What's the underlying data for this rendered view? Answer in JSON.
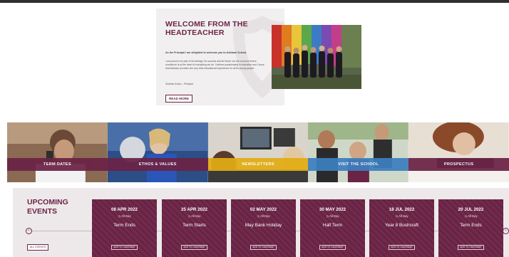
{
  "welcome": {
    "title": "WELCOME FROM THE HEADTEACHER",
    "intro": "As the Principal I am delighted to welcome you to Ashlawn School.",
    "body": "I am proud to be part of its heritage, its success and its future: we are a school where excellence is at the heart of everything we do. I believe passionately in education and I know that Ashlawn provides the very best educational experience for all its young people...",
    "signature": "Siobhan Evans - Principal",
    "read_more": "READ MORE"
  },
  "tiles": [
    {
      "label": "TERM DATES",
      "bar_color": "#6b2346"
    },
    {
      "label": "ETHOS & VALUES",
      "bar_color": "#6b2346"
    },
    {
      "label": "NEWSLETTERS",
      "bar_color": "#e2ad14"
    },
    {
      "label": "VISIT THE SCHOOL",
      "bar_color": "#3d7fc0"
    },
    {
      "label": "PROSPECTUS",
      "bar_color": "#6b2346"
    }
  ],
  "events": {
    "heading": "UPCOMING EVENTS",
    "all_events": "ALL EVENTS",
    "prev_icon": "chevron-left-icon",
    "next_icon": "chevron-right-icon",
    "items": [
      {
        "date": "08 APR 2022",
        "time": "All Day",
        "title": "Term Ends",
        "cta": "ADD TO CALENDAR"
      },
      {
        "date": "25 APR 2022",
        "time": "All Day",
        "title": "Term Starts",
        "cta": "ADD TO CALENDAR"
      },
      {
        "date": "02 MAY 2022",
        "time": "All Day",
        "title": "May Bank Holiday",
        "cta": "ADD TO CALENDAR"
      },
      {
        "date": "30 MAY 2022",
        "time": "All Day",
        "title": "Half Term",
        "cta": "ADD TO CALENDAR"
      },
      {
        "date": "18 JUL 2022",
        "time": "All Day",
        "title": "Year 8 Bushcraft",
        "cta": "ADD TO CALENDAR"
      },
      {
        "date": "20 JUL 2022",
        "time": "All Day",
        "title": "Term Ends",
        "cta": "ADD TO CALENDAR"
      }
    ]
  },
  "colors": {
    "brand": "#6b2346",
    "newsletter": "#e2ad14",
    "visit": "#3d7fc0"
  }
}
